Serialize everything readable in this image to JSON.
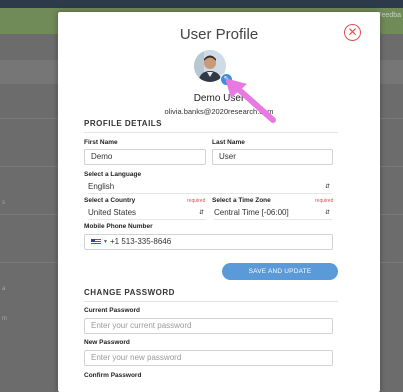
{
  "background": {
    "right_text": "Feedba",
    "left_labels": [
      "s",
      "a",
      "m"
    ]
  },
  "modal": {
    "title": "User Profile",
    "close_symbol": "✕",
    "user_name": "Demo User",
    "user_email": "olivia.banks@2020research.com",
    "edit_icon_symbol": "✎"
  },
  "profile": {
    "heading": "PROFILE DETAILS",
    "first_name_label": "First Name",
    "first_name_value": "Demo",
    "last_name_label": "Last Name",
    "last_name_value": "User",
    "language_label": "Select a Language",
    "language_value": "English",
    "country_label": "Select a Country",
    "country_required": "required",
    "country_value": "United States",
    "timezone_label": "Select a Time Zone",
    "timezone_required": "required",
    "timezone_value": "Central Time [-06:00]",
    "phone_label": "Mobile Phone Number",
    "phone_value": "+1 513-335-8646",
    "save_label": "SAVE AND UPDATE"
  },
  "password": {
    "heading": "CHANGE PASSWORD",
    "current_label": "Current Password",
    "current_placeholder": "Enter your current password",
    "new_label": "New Password",
    "new_placeholder": "Enter your new password",
    "confirm_label": "Confirm Password"
  },
  "colors": {
    "accent": "#5b9ad8",
    "close": "#e05050",
    "arrow": "#e879e0"
  },
  "icons": {
    "close": "close-icon",
    "edit": "pencil-icon",
    "select_caret": "chevron-updown-icon",
    "flag": "us-flag-icon"
  }
}
